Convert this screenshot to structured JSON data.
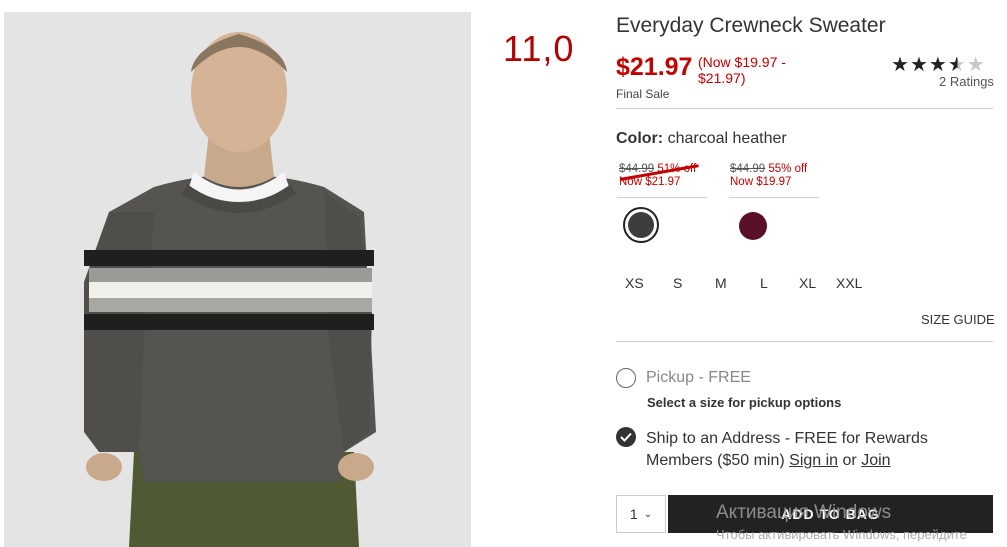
{
  "product": {
    "title": "Everyday Crewneck Sweater",
    "price": "$21.97",
    "price_range": "(Now $19.97 - $21.97)",
    "final_sale": "Final Sale",
    "rating_count": "2 Ratings",
    "rating_value": 3.5,
    "rating_max": 5
  },
  "annotation": {
    "handwritten_note": "11,0"
  },
  "color": {
    "label": "Color:",
    "value": "charcoal heather",
    "options": [
      {
        "was": "$44.99",
        "off": "51% off",
        "now": "Now $21.97",
        "swatch": "#3e3d3b"
      },
      {
        "was": "$44.99",
        "off": "55% off",
        "now": "Now $19.97",
        "swatch": "#5a1028"
      }
    ]
  },
  "sizes": [
    "XS",
    "S",
    "M",
    "L",
    "XL",
    "XXL"
  ],
  "size_guide": "SIZE GUIDE",
  "fulfillment": {
    "pickup_label": "Pickup - FREE",
    "pickup_note": "Select a size for pickup options",
    "ship_label": "Ship to an Address - FREE for Rewards Members ($50 min)",
    "sign_in": "Sign in",
    "or": "or",
    "join": "Join"
  },
  "cart": {
    "quantity": "1",
    "add_label": "ADD TO BAG"
  },
  "watermark": {
    "line1": "Активация Windows",
    "line2": "Чтобы активировать Windows, перейдите"
  },
  "colors": {
    "sale_red": "#c10000",
    "button_dark": "#222222"
  }
}
